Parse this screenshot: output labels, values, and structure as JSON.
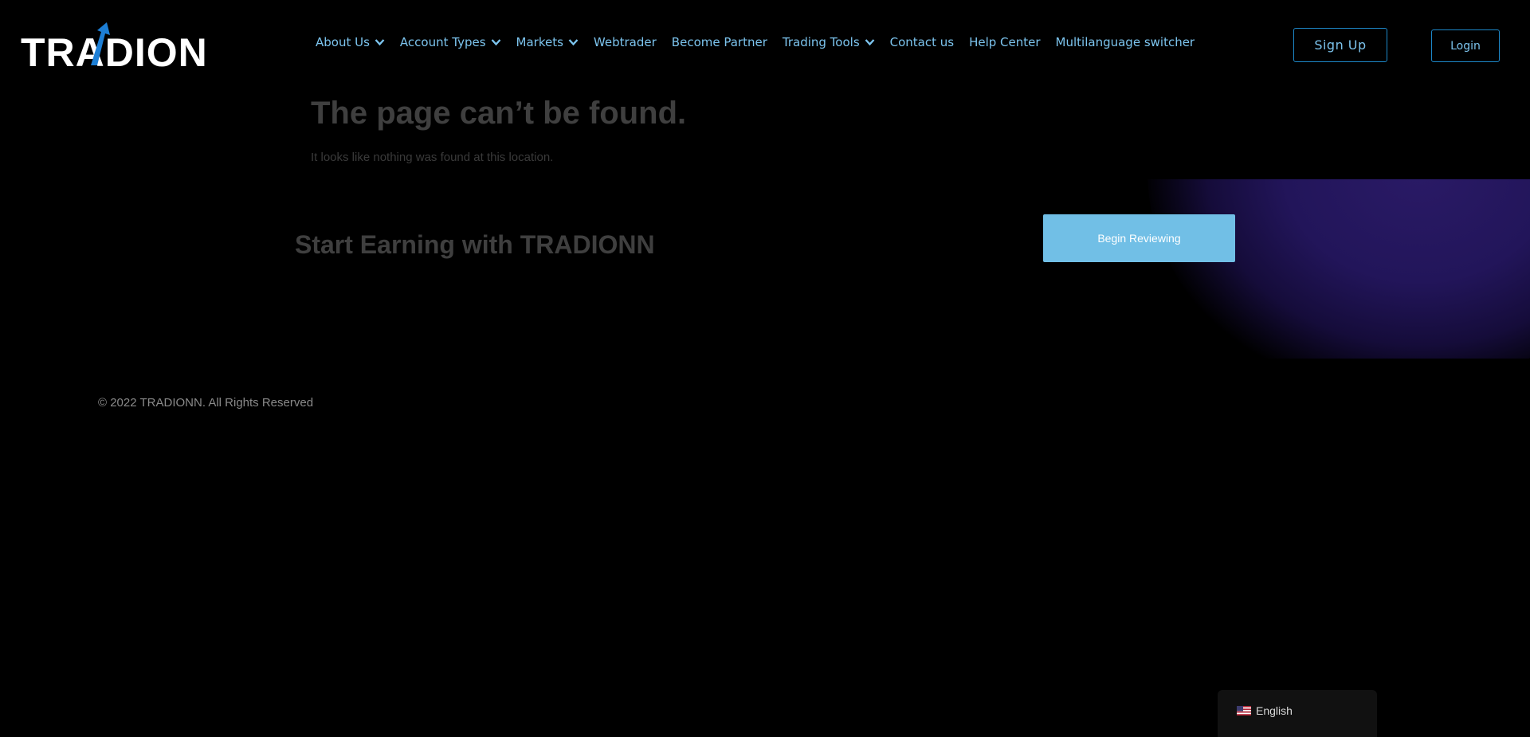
{
  "header": {
    "logo_text": "TRADION",
    "nav": [
      {
        "label": "About Us",
        "has_dropdown": true
      },
      {
        "label": "Account Types",
        "has_dropdown": true
      },
      {
        "label": "Markets",
        "has_dropdown": true
      },
      {
        "label": "Webtrader",
        "has_dropdown": false
      },
      {
        "label": "Become Partner",
        "has_dropdown": false
      },
      {
        "label": "Trading Tools",
        "has_dropdown": true
      },
      {
        "label": "Contact us",
        "has_dropdown": false
      },
      {
        "label": "Help Center",
        "has_dropdown": false
      },
      {
        "label": "Multilanguage switcher",
        "has_dropdown": false
      }
    ],
    "signup_label": "Sign Up",
    "login_label": "Login"
  },
  "main": {
    "title": "The page can’t be found.",
    "subtitle": "It looks like nothing was found at this location.",
    "cta_title": "Start Earning with TRADIONN",
    "cta_button": "Begin Reviewing"
  },
  "footer": {
    "copyright": "© 2022 TRADIONN. All Rights Reserved"
  },
  "language_switcher": {
    "label": "English",
    "flag_icon": "us-flag-icon"
  },
  "colors": {
    "background": "#000000",
    "nav_text": "#7cc4ee",
    "button_border": "#1d88c9",
    "cta_button": "#71bfe6",
    "logo_accent": "#1d7fd6",
    "glow": "#2a1a66"
  }
}
